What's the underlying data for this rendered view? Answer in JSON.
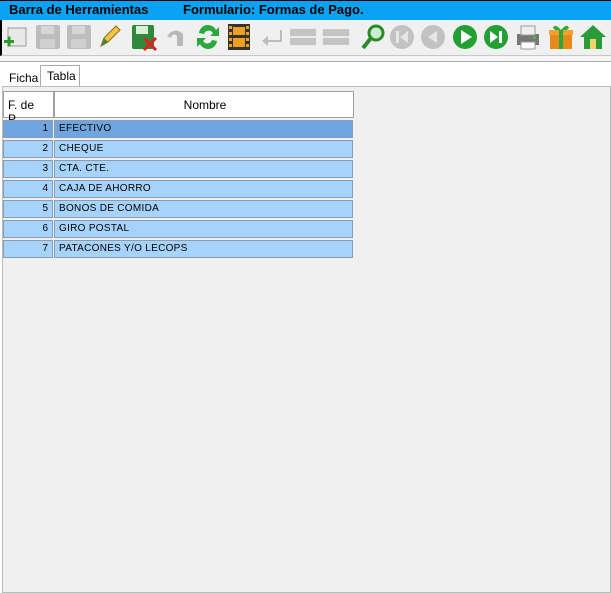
{
  "titlebar": {
    "left_text": "Barra de Herramientas",
    "right_text": "Formulario: Formas de Pago."
  },
  "toolbar": {
    "buttons": [
      {
        "name": "add-icon",
        "enabled": true
      },
      {
        "name": "save-icon",
        "enabled": false
      },
      {
        "name": "save-as-icon",
        "enabled": false
      },
      {
        "name": "edit-icon",
        "enabled": true
      },
      {
        "name": "delete-icon",
        "enabled": true
      },
      {
        "name": "undo-icon",
        "enabled": false
      },
      {
        "name": "refresh-icon",
        "enabled": true
      },
      {
        "name": "film-icon",
        "enabled": true
      },
      {
        "name": "return-icon",
        "enabled": false
      },
      {
        "name": "blank-button-1",
        "enabled": false
      },
      {
        "name": "blank-button-2",
        "enabled": false
      },
      {
        "name": "search-icon",
        "enabled": true
      },
      {
        "name": "first-record-icon",
        "enabled": false
      },
      {
        "name": "previous-record-icon",
        "enabled": false
      },
      {
        "name": "next-record-icon",
        "enabled": true
      },
      {
        "name": "last-record-icon",
        "enabled": true
      },
      {
        "name": "print-icon",
        "enabled": true
      },
      {
        "name": "gift-icon",
        "enabled": true
      },
      {
        "name": "home-icon",
        "enabled": true
      }
    ]
  },
  "tabs": {
    "ficha": "Ficha",
    "tabla": "Tabla"
  },
  "table": {
    "col_id": "F. de P...",
    "col_name": "Nombre",
    "rows": [
      {
        "id": "1",
        "name": "EFECTIVO",
        "selected": true
      },
      {
        "id": "2",
        "name": "CHEQUE",
        "selected": false
      },
      {
        "id": "3",
        "name": "CTA. CTE.",
        "selected": false
      },
      {
        "id": "4",
        "name": "CAJA DE AHORRO",
        "selected": false
      },
      {
        "id": "5",
        "name": "BONOS DE COMIDA",
        "selected": false
      },
      {
        "id": "6",
        "name": "GIRO POSTAL",
        "selected": false
      },
      {
        "id": "7",
        "name": "PATACONES Y/O LECOPS",
        "selected": false
      }
    ]
  },
  "colors": {
    "titlebar": "#0aa2f2",
    "row_bg": "#a6d3fb",
    "row_selected_bg": "#6fa6e0"
  }
}
